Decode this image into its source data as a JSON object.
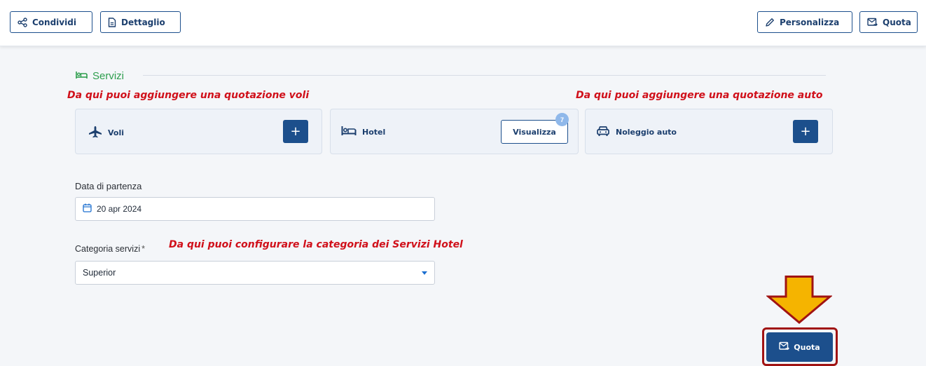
{
  "toolbar": {
    "share_label": "Condividi",
    "detail_label": "Dettaglio",
    "customize_label": "Personalizza",
    "quote_label": "Quota"
  },
  "section": {
    "title": "Servizi"
  },
  "annotations": {
    "flights": "Da qui puoi aggiungere una quotazione voli",
    "car": "Da qui puoi aggiungere una quotazione auto",
    "hotel_category": "Da qui puoi configurare la categoria dei Servizi Hotel"
  },
  "services": {
    "flights": {
      "label": "Voli",
      "action": "+",
      "icon": "plane-icon"
    },
    "hotel": {
      "label": "Hotel",
      "action": "Visualizza",
      "count": "7",
      "icon": "bed-icon"
    },
    "car": {
      "label": "Noleggio auto",
      "action": "+",
      "icon": "car-icon"
    }
  },
  "form": {
    "departure_label": "Data di partenza",
    "departure_value": "20 apr 2024",
    "category_label": "Categoria servizi",
    "category_required": "*",
    "category_value": "Superior"
  },
  "footer": {
    "quote_label": "Quota"
  },
  "colors": {
    "primary": "#1c4f8c",
    "accent_green": "#2e9e4e",
    "annotation_red": "#d0101a",
    "arrow_yellow": "#f5b400"
  }
}
